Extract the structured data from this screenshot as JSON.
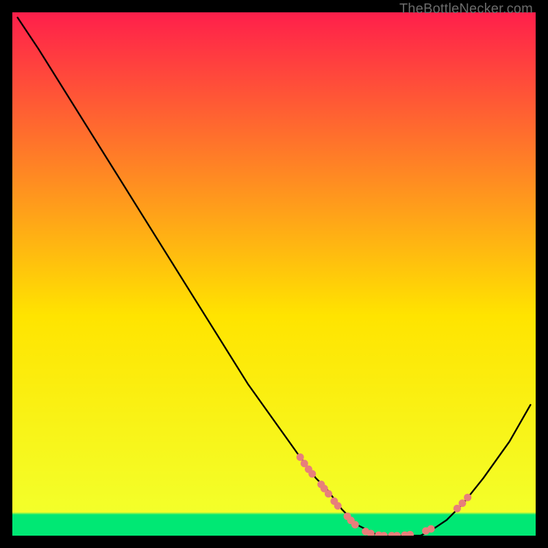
{
  "watermark": "TheBottleNecker.com",
  "chart_data": {
    "type": "line",
    "title": "",
    "xlabel": "",
    "ylabel": "",
    "xlim": [
      0,
      100
    ],
    "ylim": [
      0,
      100
    ],
    "background_gradient": {
      "top": "#ff1f4b",
      "mid": "#ffe400",
      "bottom_band": "#00e874",
      "bottom_band_start_pct": 96
    },
    "series": [
      {
        "name": "bottleneck-curve",
        "color": "#000000",
        "x": [
          1,
          5,
          10,
          15,
          20,
          25,
          30,
          35,
          40,
          45,
          50,
          55,
          58,
          60,
          63,
          66,
          70,
          74,
          78,
          80,
          83,
          86,
          90,
          95,
          99
        ],
        "y": [
          99,
          93,
          85,
          77,
          69,
          61,
          53,
          45,
          37,
          29,
          22,
          15,
          11,
          9,
          5,
          2,
          0,
          0,
          0,
          1,
          3,
          6,
          11,
          18,
          25
        ]
      }
    ],
    "markers": {
      "name": "highlight-dots",
      "color": "#e77f7b",
      "points": [
        {
          "x": 55.0,
          "y": 15.0
        },
        {
          "x": 55.8,
          "y": 13.8
        },
        {
          "x": 56.6,
          "y": 12.7
        },
        {
          "x": 57.3,
          "y": 11.8
        },
        {
          "x": 59.0,
          "y": 9.8
        },
        {
          "x": 59.6,
          "y": 9.0
        },
        {
          "x": 60.4,
          "y": 8.0
        },
        {
          "x": 61.5,
          "y": 6.6
        },
        {
          "x": 62.2,
          "y": 5.7
        },
        {
          "x": 64.0,
          "y": 3.7
        },
        {
          "x": 64.7,
          "y": 2.9
        },
        {
          "x": 65.5,
          "y": 2.1
        },
        {
          "x": 67.5,
          "y": 0.8
        },
        {
          "x": 68.5,
          "y": 0.4
        },
        {
          "x": 70.0,
          "y": 0.1
        },
        {
          "x": 71.0,
          "y": 0.0
        },
        {
          "x": 72.5,
          "y": 0.0
        },
        {
          "x": 73.5,
          "y": 0.0
        },
        {
          "x": 75.0,
          "y": 0.1
        },
        {
          "x": 76.0,
          "y": 0.2
        },
        {
          "x": 79.0,
          "y": 0.9
        },
        {
          "x": 80.0,
          "y": 1.3
        },
        {
          "x": 85.0,
          "y": 5.2
        },
        {
          "x": 86.0,
          "y": 6.2
        },
        {
          "x": 87.0,
          "y": 7.3
        }
      ]
    }
  }
}
